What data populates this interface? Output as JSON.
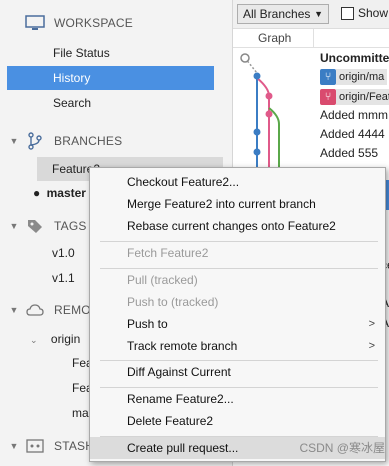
{
  "sidebar": {
    "workspace": {
      "title": "WORKSPACE",
      "items": [
        "File Status",
        "History",
        "Search"
      ]
    },
    "branches": {
      "title": "BRANCHES",
      "items": [
        "Feature2",
        "master"
      ]
    },
    "tags": {
      "title": "TAGS",
      "items": [
        "v1.0",
        "v1.1"
      ]
    },
    "remotes": {
      "title": "REMOTES",
      "origin": "origin",
      "items": [
        "Fea",
        "Fea",
        "ma"
      ]
    },
    "stashes": {
      "title": "STASH"
    }
  },
  "toolbar": {
    "branch_filter": "All Branches",
    "show_label": "Show"
  },
  "graph": {
    "header": "Graph",
    "rows": [
      {
        "text": "Uncommitted"
      },
      {
        "tag": "origin/ma"
      },
      {
        "tag": "origin/Feat"
      },
      {
        "text": "Added mmm"
      },
      {
        "text": "Added 4444"
      },
      {
        "text": "Added 555"
      }
    ],
    "partial": [
      "ce",
      "A",
      "A"
    ]
  },
  "menu": {
    "items": [
      {
        "label": "Checkout Feature2...",
        "enabled": true
      },
      {
        "label": "Merge Feature2 into current branch",
        "enabled": true
      },
      {
        "label": "Rebase current changes onto Feature2",
        "enabled": true
      },
      {
        "label": "Fetch Feature2",
        "enabled": false
      },
      {
        "label": "Pull  (tracked)",
        "enabled": false
      },
      {
        "label": "Push to  (tracked)",
        "enabled": false
      },
      {
        "label": "Push to",
        "enabled": true,
        "submenu": true
      },
      {
        "label": "Track remote branch",
        "enabled": true,
        "submenu": true
      },
      {
        "label": "Diff Against Current",
        "enabled": true
      },
      {
        "label": "Rename Feature2...",
        "enabled": true
      },
      {
        "label": "Delete Feature2",
        "enabled": true
      },
      {
        "label": "Create pull request...",
        "enabled": true,
        "hover": true
      }
    ]
  },
  "colors": {
    "selection": "#4a90e2",
    "tag_blue": "#3b7dc4",
    "tag_pink": "#d94b6e",
    "line_pink": "#e05a8a",
    "line_green": "#5aa84a"
  },
  "watermark": "CSDN @寒冰屋"
}
